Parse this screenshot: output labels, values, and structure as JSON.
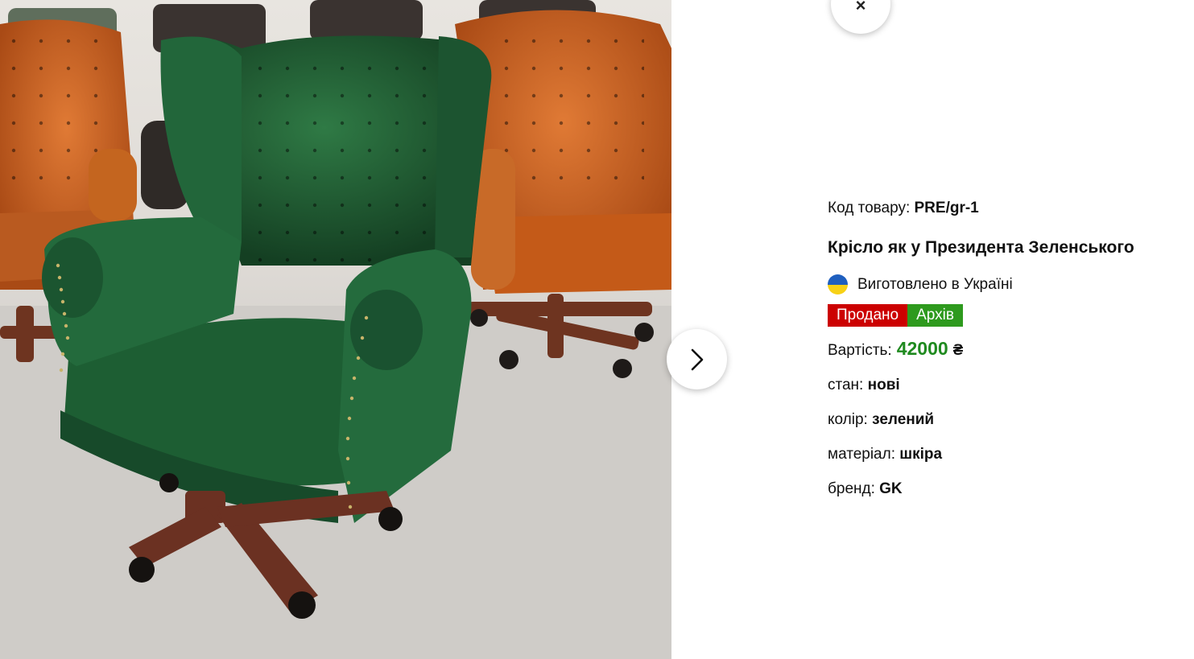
{
  "product": {
    "sku_label": "Код товару:",
    "sku_value": "PRE/gr-1",
    "title": "Крісло як у Президента Зеленського",
    "made_in": "Виготовлено в Україні",
    "badges": [
      "Продано",
      "Архів"
    ],
    "price_label": "Вартість:",
    "price_value": "42000",
    "currency": "₴",
    "attributes": [
      {
        "label": "стан:",
        "value": "нові"
      },
      {
        "label": "колір:",
        "value": "зелений"
      },
      {
        "label": "матеріал:",
        "value": "шкіра"
      },
      {
        "label": "бренд:",
        "value": "GK"
      }
    ]
  },
  "controls": {
    "close_label": "×"
  },
  "colors": {
    "sold_badge": "#cc0000",
    "archive_badge": "#2e9a1e",
    "price": "#1f8a1f",
    "chair_green": "#1f5a30",
    "chair_orange": "#c8621f"
  }
}
